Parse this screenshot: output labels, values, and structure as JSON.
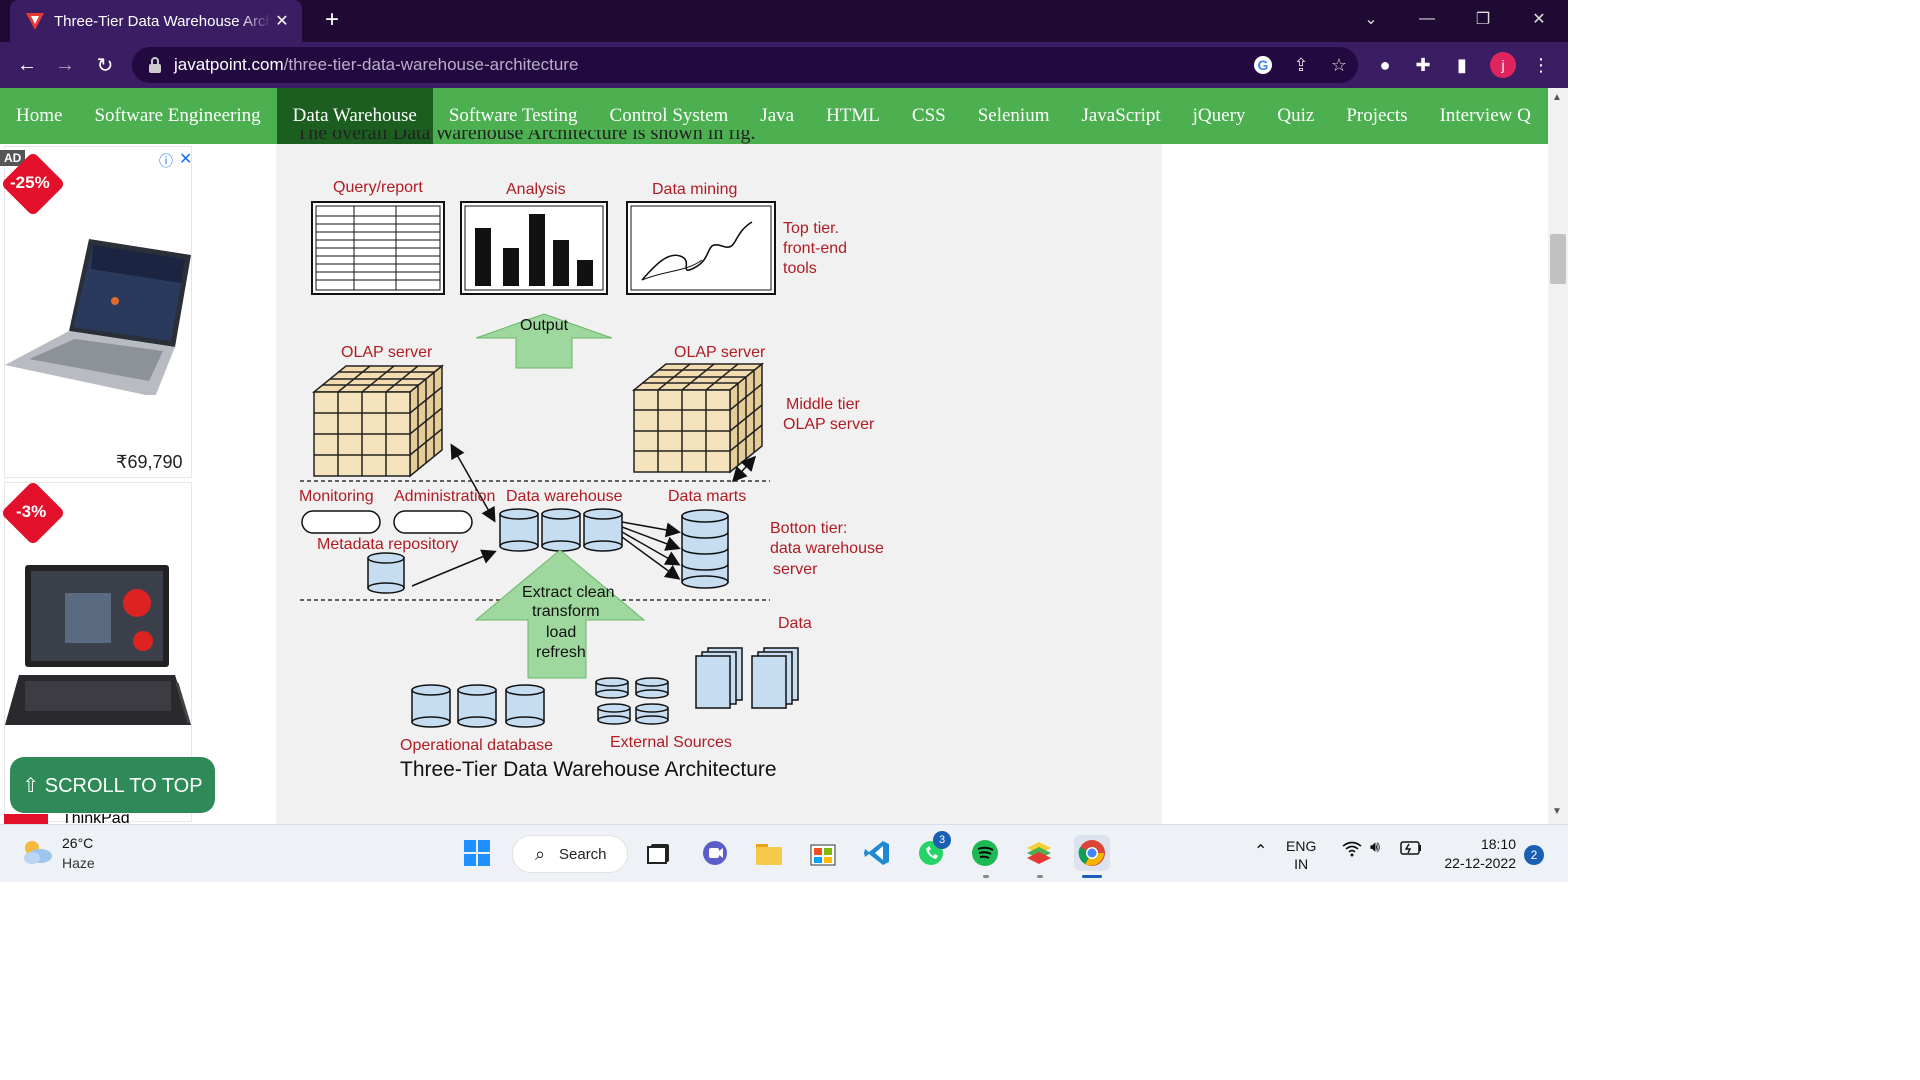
{
  "browser": {
    "tab_title": "Three-Tier Data Warehouse Architecture",
    "tab_close": "✕",
    "new_tab": "+",
    "url_domain": "javatpoint.com",
    "url_path": "/three-tier-data-warehouse-architecture",
    "profile_initial": "j"
  },
  "sitenav": {
    "items": [
      "Home",
      "Software Engineering",
      "Data Warehouse",
      "Software Testing",
      "Control System",
      "Java",
      "HTML",
      "CSS",
      "Selenium",
      "JavaScript",
      "jQuery",
      "Quiz",
      "Projects",
      "Interview Q"
    ],
    "active": "Data Warehouse",
    "active_color": "#1b5e20",
    "bar_color": "#4caf50"
  },
  "article": {
    "prev_text": "The overall Data Warehouse Architecture is shown in fig."
  },
  "ads": {
    "ad_label": "AD",
    "card1_discount": "-25%",
    "card1_price": "₹69,790",
    "card2_discount": "-3%",
    "card2_partial_title": "ThinkPad"
  },
  "scroll_top": "⇧ SCROLL TO TOP",
  "diagram": {
    "query_report": "Query/report",
    "analysis": "Analysis",
    "data_mining": "Data mining",
    "top_tier_1": "Top tier.",
    "top_tier_2": "front-end",
    "top_tier_3": "tools",
    "output": "Output",
    "olap_server_left": "OLAP server",
    "olap_server_right": "OLAP server",
    "middle_tier_1": "Middle tier",
    "middle_tier_2": "OLAP server",
    "monitoring": "Monitoring",
    "administration": "Administration",
    "data_warehouse": "Data warehouse",
    "data_marts": "Data marts",
    "metadata_repository": "Metadata repository",
    "bottom_tier_1": "Botton tier:",
    "bottom_tier_2": "data warehouse",
    "bottom_tier_3": "server",
    "etl_1": "Extract clean",
    "etl_2": "transform",
    "etl_3": "load",
    "etl_4": "refresh",
    "data": "Data",
    "operational_database": "Operational database",
    "external_sources": "External Sources",
    "caption": "Three-Tier Data Warehouse Architecture"
  },
  "taskbar": {
    "temperature": "26°C",
    "condition": "Haze",
    "search": "Search",
    "whatsapp_badge": "3",
    "lang_1": "ENG",
    "lang_2": "IN",
    "time": "18:10",
    "date": "22-12-2022",
    "notifications": "2"
  }
}
